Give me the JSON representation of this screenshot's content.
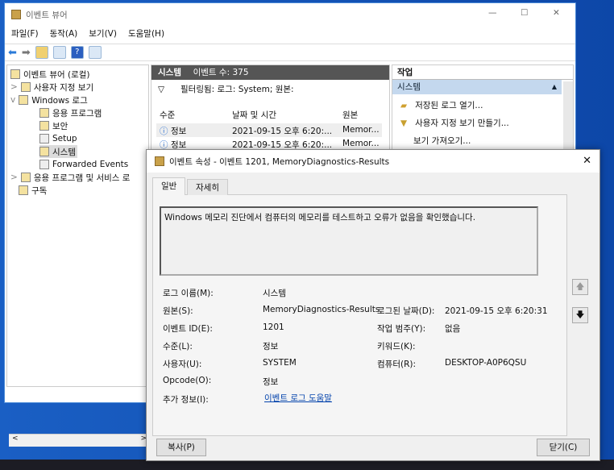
{
  "window": {
    "title": "이벤트 뷰어",
    "minimize": "—",
    "maximize": "☐",
    "close": "✕"
  },
  "menu": [
    "파일(F)",
    "동작(A)",
    "보기(V)",
    "도움말(H)"
  ],
  "toolbar": {
    "back": "⬅",
    "forward": "➡",
    "help": "?"
  },
  "tree": [
    {
      "label": "이벤트 뷰어 (로컬)",
      "expander": ""
    },
    {
      "label": "사용자 지정 보기",
      "expander": ">"
    },
    {
      "label": "Windows 로그",
      "expander": "v"
    },
    {
      "label": "응용 프로그램",
      "expander": ""
    },
    {
      "label": "보안",
      "expander": ""
    },
    {
      "label": "Setup",
      "expander": ""
    },
    {
      "label": "시스템",
      "expander": "",
      "selected": true
    },
    {
      "label": "Forwarded Events",
      "expander": ""
    },
    {
      "label": "응용 프로그램 및 서비스 로",
      "expander": ">"
    },
    {
      "label": "구독",
      "expander": ""
    }
  ],
  "scroll": {
    "left": "<",
    "right": ">"
  },
  "center": {
    "title": "시스템",
    "count": "이벤트 수: 375",
    "filter": "필터링됨: 로그: System; 원본:",
    "columns": [
      "수준",
      "날짜 및 시간",
      "원본"
    ],
    "rows": [
      [
        "정보",
        "2021-09-15 오후 6:20:...",
        "Memor..."
      ],
      [
        "정보",
        "2021-09-15 오후 6:20:...",
        "Memor..."
      ]
    ]
  },
  "actions": {
    "title": "작업",
    "section": "시스템",
    "items": [
      "저장된 로그 열기...",
      "사용자 지정 보기 만들기...",
      "보기 가져오기..."
    ]
  },
  "dialog": {
    "title": "이벤트 속성 - 이벤트 1201, MemoryDiagnostics-Results",
    "close": "✕",
    "tabs": [
      "일반",
      "자세히"
    ],
    "description": "Windows 메모리 진단에서 컴퓨터의 메모리를 테스트하고 오류가 없음을 확인했습니다.",
    "fields_left": [
      {
        "label": "로그 이름(M):",
        "value": "시스템"
      },
      {
        "label": "원본(S):",
        "value": "MemoryDiagnostics-Results"
      },
      {
        "label": "이벤트 ID(E):",
        "value": "1201"
      },
      {
        "label": "수준(L):",
        "value": "정보"
      },
      {
        "label": "사용자(U):",
        "value": "SYSTEM"
      },
      {
        "label": "Opcode(O):",
        "value": "정보"
      },
      {
        "label": "추가 정보(I):",
        "value": "이벤트 로그 도움말"
      }
    ],
    "fields_right": [
      {
        "label": "로그된 날짜(D):",
        "value": "2021-09-15 오후 6:20:31"
      },
      {
        "label": "작업 범주(Y):",
        "value": "없음"
      },
      {
        "label": "키워드(K):",
        "value": ""
      },
      {
        "label": "컴퓨터(R):",
        "value": "DESKTOP-A0P6QSU"
      }
    ],
    "copy": "복사(P)",
    "closebtn": "닫기(C)",
    "up": "🡅",
    "down": "🡇"
  }
}
